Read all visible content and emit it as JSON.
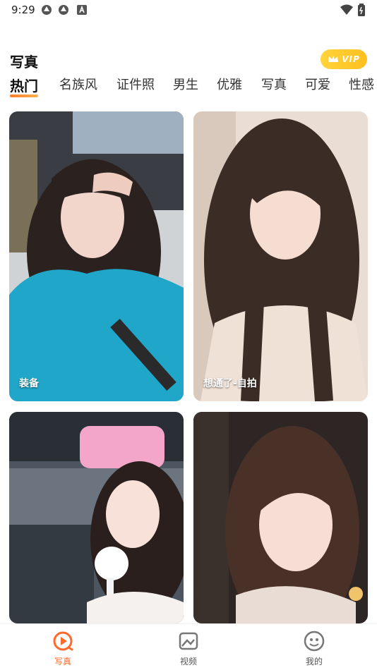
{
  "status": {
    "time": "9:29"
  },
  "header": {
    "title": "写真",
    "vip_label": "VIP"
  },
  "tabs": [
    {
      "label": "热门",
      "active": true
    },
    {
      "label": "名族风"
    },
    {
      "label": "证件照"
    },
    {
      "label": "男生"
    },
    {
      "label": "优雅"
    },
    {
      "label": "写真"
    },
    {
      "label": "可爱"
    },
    {
      "label": "性感"
    }
  ],
  "cards": [
    {
      "label": "装备"
    },
    {
      "label": "想通了-自拍"
    },
    {
      "label": ""
    },
    {
      "label": ""
    }
  ],
  "nav": [
    {
      "label": "写真",
      "icon": "play-icon",
      "active": true
    },
    {
      "label": "视频",
      "icon": "image-icon"
    },
    {
      "label": "我的",
      "icon": "smile-icon"
    }
  ],
  "colors": {
    "accent": "#ff6a2b",
    "vip": "#ffc72c"
  }
}
